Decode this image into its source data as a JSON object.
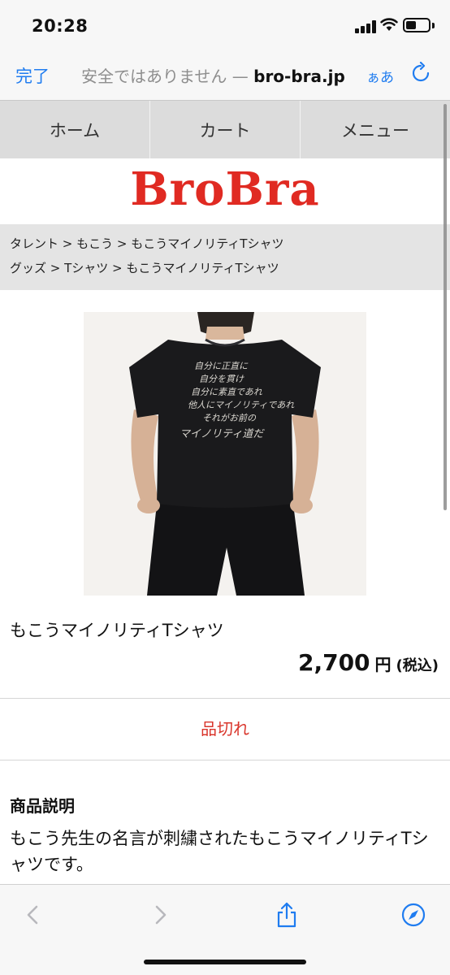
{
  "status_bar": {
    "time": "20:28"
  },
  "address_bar": {
    "done_label": "完了",
    "security_warning": "安全ではありません — ",
    "domain": "bro-bra.jp",
    "text_size_label": "ぁあ"
  },
  "site_nav": {
    "items": [
      "ホーム",
      "カート",
      "メニュー"
    ]
  },
  "logo_text": "BroBra",
  "breadcrumbs": [
    "タレント > もこう > もこうマイノリティTシャツ",
    "グッズ > Tシャツ > もこうマイノリティTシャツ"
  ],
  "product": {
    "name": "もこうマイノリティTシャツ",
    "price_value": "2,700",
    "price_unit": "円",
    "price_tax": "(税込)",
    "status": "品切れ",
    "description_heading": "商品説明",
    "description": "もこう先生の名言が刺繍されたもこうマイノリティTシャツです。",
    "shirt_print_lines": [
      "自分に正直に",
      "自分を貫け",
      "自分に素直であれ",
      "他人にマイノリティであれ",
      "それがお前の",
      "マイノリティ道だ"
    ]
  },
  "colors": {
    "accent": "#1f7cf0",
    "brand": "#e02a22",
    "soldout": "#d9352b"
  },
  "toolbar": {
    "icons": [
      "back-icon",
      "forward-icon",
      "share-icon",
      "compass-icon"
    ]
  }
}
